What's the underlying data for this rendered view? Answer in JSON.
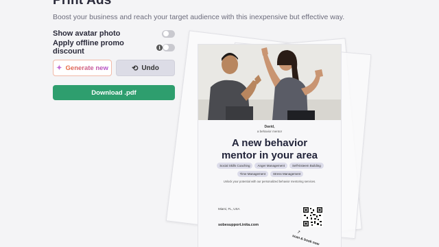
{
  "header": {
    "title": "Print Ads",
    "subtitle": "Boost your business and reach your target audience with this inexpensive but effective way."
  },
  "options": {
    "show_avatar_label": "Show avatar photo",
    "show_avatar_on": false,
    "offline_promo_label": "Apply offline promo discount",
    "offline_promo_on": false
  },
  "actions": {
    "generate_label": "Generate new",
    "undo_label": "Undo",
    "download_label": "Download .pdf"
  },
  "ad": {
    "mentor_name": "David,",
    "mentor_role": "a behavior mentor",
    "headline_line1": "A new behavior",
    "headline_line2": "mentor in your area",
    "tags": [
      "Social Skills Coaching",
      "Anger Management",
      "Self-Esteem Building",
      "Time Management",
      "Stress Management"
    ],
    "description": "Unlock your potential with our personalized behavior mentoring services.",
    "location": "Miami, FL, USA",
    "website": "sobesupport.inita.com",
    "scan_text": "scan & book now"
  },
  "colors": {
    "primary_green": "#2e9e6e",
    "generate_gradient_start": "#e86a3a",
    "generate_gradient_end": "#b14bd1",
    "undo_bg": "#dcdce6",
    "headline": "#22243a"
  },
  "icons": {
    "generate": "sparkle-icon",
    "undo": "undo-arrow-icon",
    "info": "info-icon"
  }
}
